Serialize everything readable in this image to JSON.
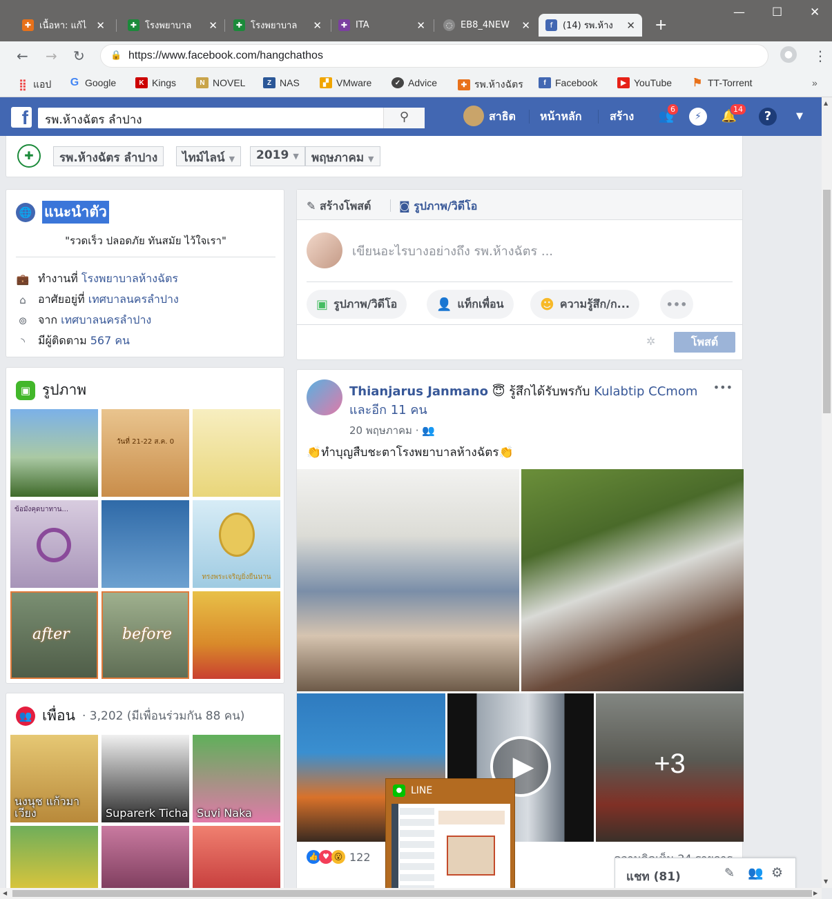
{
  "tabs": [
    {
      "title": "เนื้อหา: แก้ไ",
      "icon": "app-icon",
      "color": "#e8711a"
    },
    {
      "title": "โรงพยาบาล",
      "icon": "hospital-icon",
      "color": "#1b8a3a"
    },
    {
      "title": "โรงพยาบาล",
      "icon": "hospital-icon",
      "color": "#1b8a3a"
    },
    {
      "title": "ITA",
      "icon": "app-icon",
      "color": "#7b3fa0"
    },
    {
      "title": "EB8_4NEW",
      "icon": "loading-icon",
      "color": "#8a8a8a"
    },
    {
      "title": "(14) รพ.ห้าง",
      "icon": "facebook-icon",
      "color": "#4267b2"
    }
  ],
  "url": "https://www.facebook.com/hangchathos",
  "bookmarks": [
    {
      "label": "แอป",
      "icon": "apps-grid-icon",
      "color": "#e44"
    },
    {
      "label": "Google",
      "icon": "google-icon",
      "color": "#4285f4"
    },
    {
      "label": "Kings",
      "icon": "kings-icon",
      "color": "#c00"
    },
    {
      "label": "NOVEL",
      "icon": "novel-icon",
      "color": "#c9a44a"
    },
    {
      "label": "NAS",
      "icon": "nas-icon",
      "color": "#2b5797"
    },
    {
      "label": "VMware",
      "icon": "vmware-icon",
      "color": "#f0a500"
    },
    {
      "label": "Advice",
      "icon": "advice-icon",
      "color": "#444"
    },
    {
      "label": "รพ.ห้างฉัตร",
      "icon": "hospital-icon",
      "color": "#e8711a"
    },
    {
      "label": "Facebook",
      "icon": "facebook-icon",
      "color": "#4267b2"
    },
    {
      "label": "YouTube",
      "icon": "youtube-icon",
      "color": "#e62117"
    },
    {
      "label": "TT-Torrent",
      "icon": "torrent-icon",
      "color": "#e8711a"
    }
  ],
  "bookmarks_more": "»",
  "fb": {
    "search_value": "รพ.ห้างฉัตร ลำปาง",
    "profile_name": "สาธิต",
    "home": "หน้าหลัก",
    "create": "สร้าง",
    "friend_requests": "6",
    "notifications": "14"
  },
  "crumb": {
    "logo_text": "✚",
    "page": "รพ.ห้างฉัตร ลำปาง",
    "view": "ไทม์ไลน์",
    "year": "2019",
    "month": "พฤษภาคม"
  },
  "intro": {
    "title": "แนะนำตัว",
    "quote": "\"รวดเร็ว ปลอดภัย ทันสมัย ไว้ใจเรา\"",
    "work_prefix": "ทำงานที่",
    "work": "โรงพยาบาลห้างฉัตร",
    "lives_prefix": "อาศัยอยู่ที่",
    "lives": "เทศบาลนครลำปาง",
    "from_prefix": "จาก",
    "from": "เทศบาลนครลำปาง",
    "followers_prefix": "มีผู้ติดตาม",
    "followers": "567 คน"
  },
  "photos": {
    "title": "รูปภาพ",
    "items": [
      {
        "color": "#5a8fd0",
        "caption": ""
      },
      {
        "color": "#d9a86c",
        "caption": "วันที่ 21-22 ส.ค. 0"
      },
      {
        "color": "#f2e6a0",
        "caption": ""
      },
      {
        "color": "#bba9c7",
        "caption": "ข้อมังคุดบาทาน..."
      },
      {
        "color": "#4a86b8",
        "caption": ""
      },
      {
        "color": "#a8d4e8",
        "caption": "ทรงพระเจริญยิ่งยืนนาน"
      },
      {
        "color": "#7a8f72",
        "caption": "after"
      },
      {
        "color": "#8c9a86",
        "caption": "before"
      },
      {
        "color": "#d9a930",
        "caption": ""
      }
    ]
  },
  "friends": {
    "title": "เพื่อน",
    "count": "· 3,202 (มีเพื่อนร่วมกัน 88 คน)",
    "items": [
      {
        "name": "นงนุช แก้วมา เวียง",
        "color": "#d7b44c"
      },
      {
        "name": "Suparerk Ticha",
        "color": "#3b3b3b"
      },
      {
        "name": "Suvi Naka",
        "color": "#e07aa8"
      },
      {
        "name": "",
        "color": "#c9b13a"
      },
      {
        "name": "",
        "color": "#b56b8a"
      },
      {
        "name": "",
        "color": "#d95b4a"
      }
    ]
  },
  "composer": {
    "tab_create": "สร้างโพสต์",
    "tab_media": "รูปภาพ/วิดีโอ",
    "placeholder": "เขียนอะไรบางอย่างถึง รพ.ห้างฉัตร ...",
    "btn_media": "รูปภาพ/วิดีโอ",
    "btn_tag": "แท็กเพื่อน",
    "btn_feeling": "ความรู้สึก/ก...",
    "btn_more": "•••",
    "post": "โพสต์"
  },
  "post": {
    "author": "Thianjarus Janmano",
    "feeling": "รู้สึกได้รับพรกับ",
    "with": "Kulabtip CCmom",
    "and_others": "และอีก 11 คน",
    "date": "20 พฤษภาคม ·",
    "text": "ทำบุญสืบชะตาโรงพยาบาลห้างฉัตร",
    "more_photos": "+3",
    "reactions": "122",
    "comments": "ความคิดเห็น 24 รายการ",
    "menu": "•••"
  },
  "line_popup": {
    "title": "LINE"
  },
  "chat": {
    "label": "แชท (81)"
  },
  "colors": {
    "fb_blue": "#4267b2",
    "link": "#385898",
    "chrome_dark": "#686766"
  }
}
